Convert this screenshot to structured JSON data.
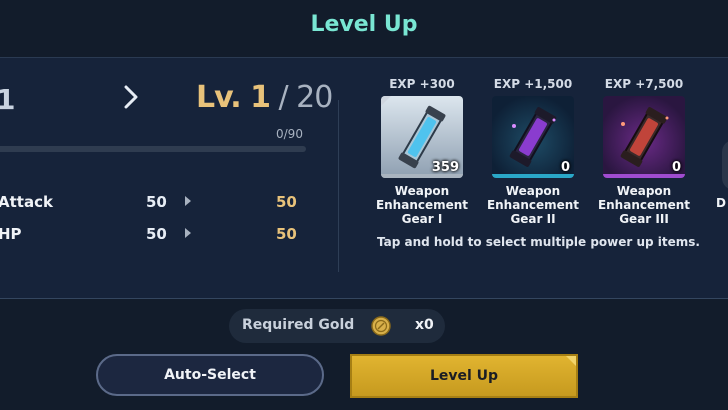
{
  "header": {
    "title": "Level Up"
  },
  "level": {
    "previous_fragment": "1",
    "current": "Lv. 1",
    "separator": " / ",
    "max": "20",
    "exp_text": "0/90",
    "exp_progress": 0
  },
  "stats": [
    {
      "name": "Attack",
      "current": "50",
      "next": "50"
    },
    {
      "name": "HP",
      "current": "50",
      "next": "50"
    }
  ],
  "items": [
    {
      "exp": "EXP +300",
      "name_lines": [
        "Weapon",
        "Enhancement",
        "Gear I"
      ],
      "count": "359",
      "rarity_color": "#a9b4c0"
    },
    {
      "exp": "EXP +1,500",
      "name_lines": [
        "Weapon",
        "Enhancement",
        "Gear II"
      ],
      "count": "0",
      "rarity_color": "#2aa8c8"
    },
    {
      "exp": "EXP +7,500",
      "name_lines": [
        "Weapon",
        "Enhancement",
        "Gear III"
      ],
      "count": "0",
      "rarity_color": "#a04cd0"
    }
  ],
  "partial_item_label": "D",
  "hint": "Tap and hold to select multiple power up items.",
  "gold": {
    "label": "Required Gold",
    "amount": "x0"
  },
  "buttons": {
    "auto_select": "Auto-Select",
    "level_up": "Level Up"
  },
  "colors": {
    "accent_teal": "#79e6d3",
    "gold": "#e8c27a",
    "button_gold": "#d6a828",
    "background": "#121c2b"
  },
  "icons": {
    "coin": "gold-coin-icon",
    "arrow": "chevron-right-icon"
  }
}
